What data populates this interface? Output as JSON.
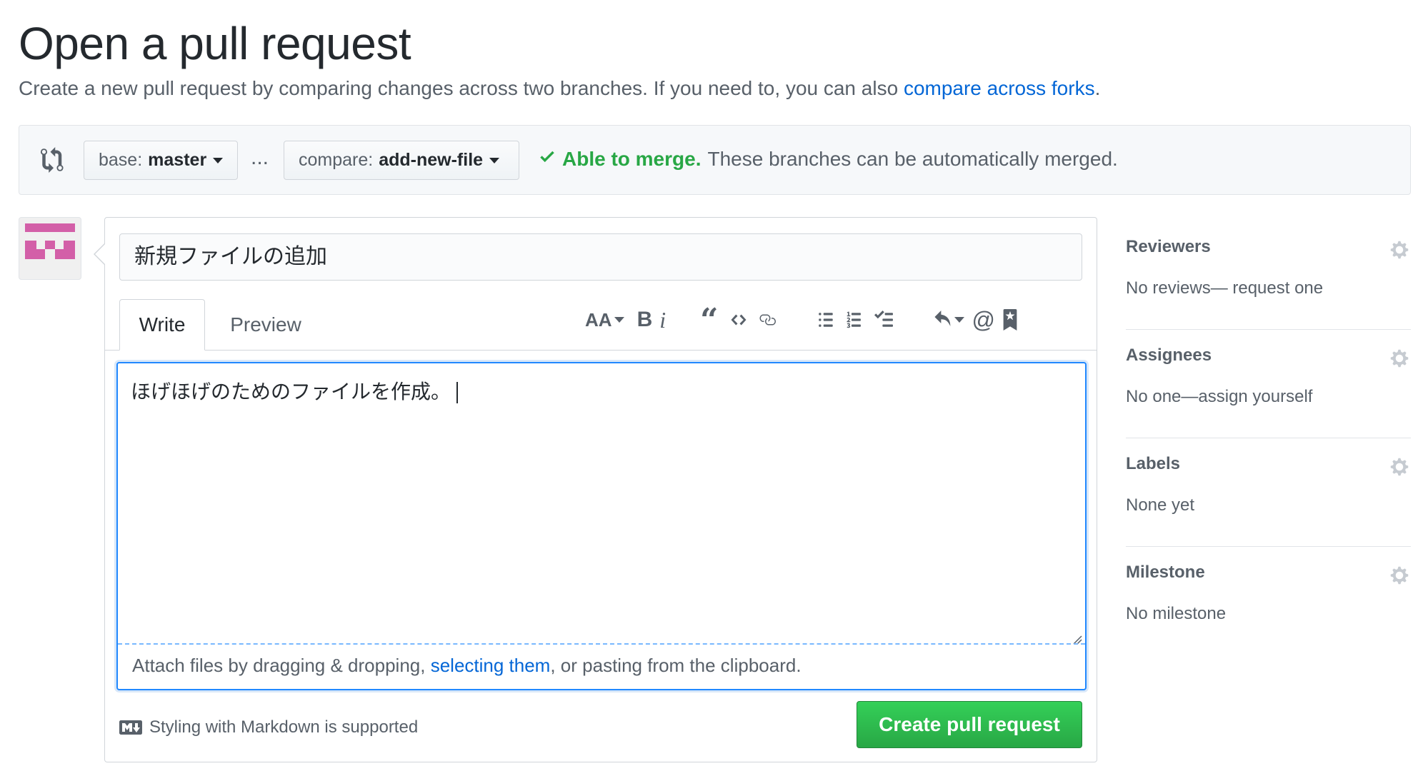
{
  "header": {
    "title": "Open a pull request",
    "subtitle_prefix": "Create a new pull request by comparing changes across two branches. If you need to, you can also ",
    "subtitle_link": "compare across forks",
    "subtitle_suffix": "."
  },
  "range": {
    "base_label": "base:",
    "base_branch": "master",
    "separator": "...",
    "compare_label": "compare:",
    "compare_branch": "add-new-file",
    "merge_ok": "Able to merge.",
    "merge_text": "These branches can be automatically merged."
  },
  "form": {
    "title_value": "新規ファイルの追加",
    "tabs": [
      {
        "label": "Write",
        "active": true
      },
      {
        "label": "Preview",
        "active": false
      }
    ],
    "toolbar_icons": [
      "text-size-icon",
      "bold-icon",
      "italic-icon",
      "quote-icon",
      "code-icon",
      "link-icon",
      "unordered-list-icon",
      "ordered-list-icon",
      "task-list-icon",
      "reply-icon",
      "mention-icon",
      "bookmark-icon"
    ],
    "body_value": "ほげほげのためのファイルを作成。",
    "attach_prefix": "Attach files by dragging & dropping, ",
    "attach_link": "selecting them",
    "attach_suffix": ", or pasting from the clipboard.",
    "markdown_note": "Styling with Markdown is supported",
    "submit_label": "Create pull request"
  },
  "sidebar": {
    "sections": [
      {
        "heading": "Reviewers",
        "text": "No reviews— request one"
      },
      {
        "heading": "Assignees",
        "text": "No one—assign yourself"
      },
      {
        "heading": "Labels",
        "text": "None yet"
      },
      {
        "heading": "Milestone",
        "text": "No milestone"
      }
    ]
  },
  "colors": {
    "link": "#0366d6",
    "success": "#28a745",
    "focus": "#2188ff",
    "avatar": "#d35fa8"
  }
}
